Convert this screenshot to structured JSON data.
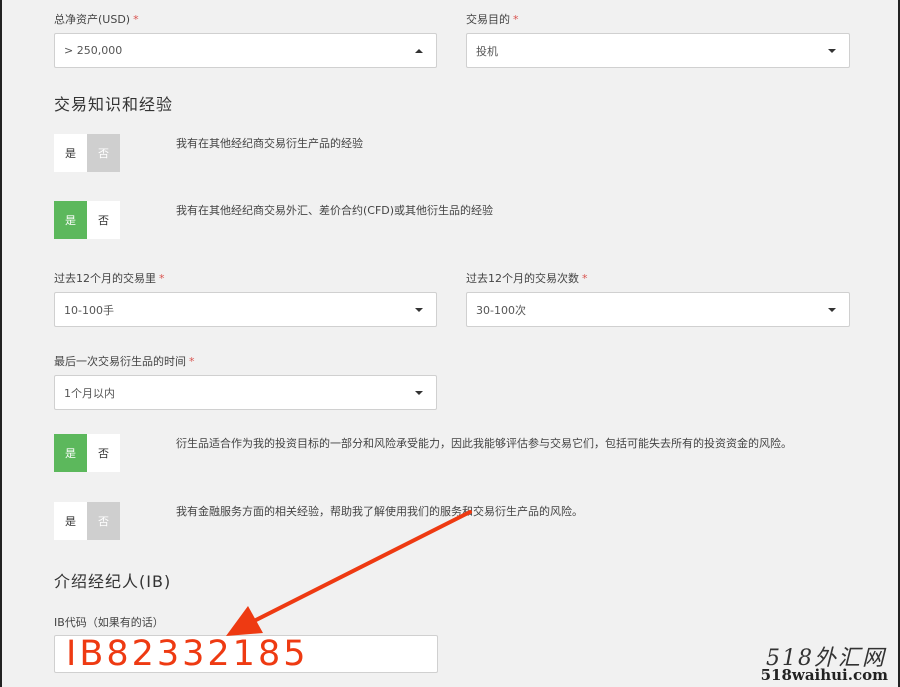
{
  "fields": {
    "total_assets": {
      "label": "总净资产(USD)",
      "value": "> 250,000"
    },
    "trading_purpose": {
      "label": "交易目的",
      "value": "投机"
    },
    "volume_12m": {
      "label": "过去12个月的交易里",
      "value": "10-100手"
    },
    "count_12m": {
      "label": "过去12个月的交易次数",
      "value": "30-100次"
    },
    "last_trade": {
      "label": "最后一次交易衍生品的时间",
      "value": "1个月以内"
    }
  },
  "required_mark": "*",
  "section_experience": {
    "title": "交易知识和经验"
  },
  "toggle_labels": {
    "yes": "是",
    "no": "否"
  },
  "questions": [
    {
      "text": "我有在其他经纪商交易衍生产品的经验",
      "answer": "yes"
    },
    {
      "text": "我有在其他经纪商交易外汇、差价合约(CFD)或其他衍生品的经验",
      "answer": "yes"
    },
    {
      "text": "衍生品适合作为我的投资目标的一部分和风险承受能力，因此我能够评估参与交易它们，包括可能失去所有的投资资金的风险。",
      "answer": "yes"
    },
    {
      "text": "我有金融服务方面的相关经验，帮助我了解使用我们的服务和交易衍生产品的风险。",
      "answer": "yes"
    }
  ],
  "section_ib": {
    "title": "介绍经纪人(IB)",
    "field_label": "IB代码（如果有的话）",
    "value": "IB82332185"
  },
  "watermark": {
    "cn": "518外汇网",
    "en": "518waihui.com"
  },
  "colors": {
    "accent_green": "#5cb85c",
    "required_red": "#d9534f",
    "annotation_red": "#ee3a12"
  }
}
